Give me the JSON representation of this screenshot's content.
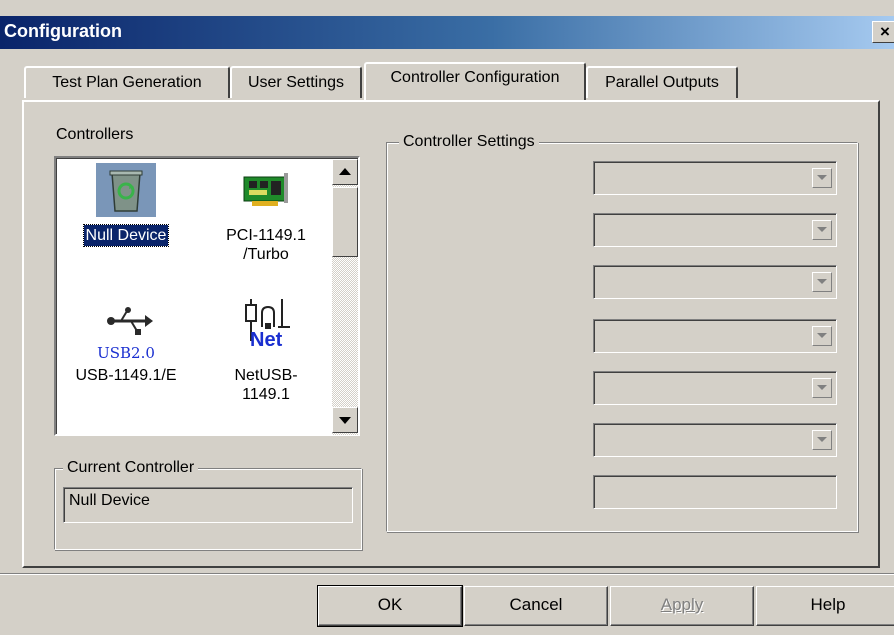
{
  "window": {
    "title": "Configuration",
    "close_glyph": "×"
  },
  "tabs": [
    {
      "label": "Test Plan Generation",
      "active": false
    },
    {
      "label": "User Settings",
      "active": false
    },
    {
      "label": "Controller Configuration",
      "active": true
    },
    {
      "label": "Parallel Outputs",
      "active": false
    }
  ],
  "controllers": {
    "label": "Controllers",
    "items": [
      {
        "name": "Null Device",
        "icon": "recycle-bin-icon",
        "selected": true
      },
      {
        "name": "PCI-1149.1\n/Turbo",
        "icon": "pci-card-icon",
        "selected": false
      },
      {
        "name": "USB-1149.1/E",
        "icon": "usb-icon",
        "icon_text": "USB2.0",
        "selected": false
      },
      {
        "name": "NetUSB-\n1149.1",
        "icon": "net-usb-icon",
        "icon_text": "Net",
        "selected": false
      }
    ]
  },
  "current_controller": {
    "label": "Current Controller",
    "value": "Null Device"
  },
  "controller_settings": {
    "label": "Controller Settings",
    "dropdown_count": 6
  },
  "buttons": {
    "ok": "OK",
    "cancel": "Cancel",
    "apply": "Apply",
    "help": "Help"
  },
  "colors": {
    "selection": "#0a246a",
    "titlebar_start": "#0a246a",
    "titlebar_end": "#a6caf0",
    "face": "#d4d0c8"
  }
}
